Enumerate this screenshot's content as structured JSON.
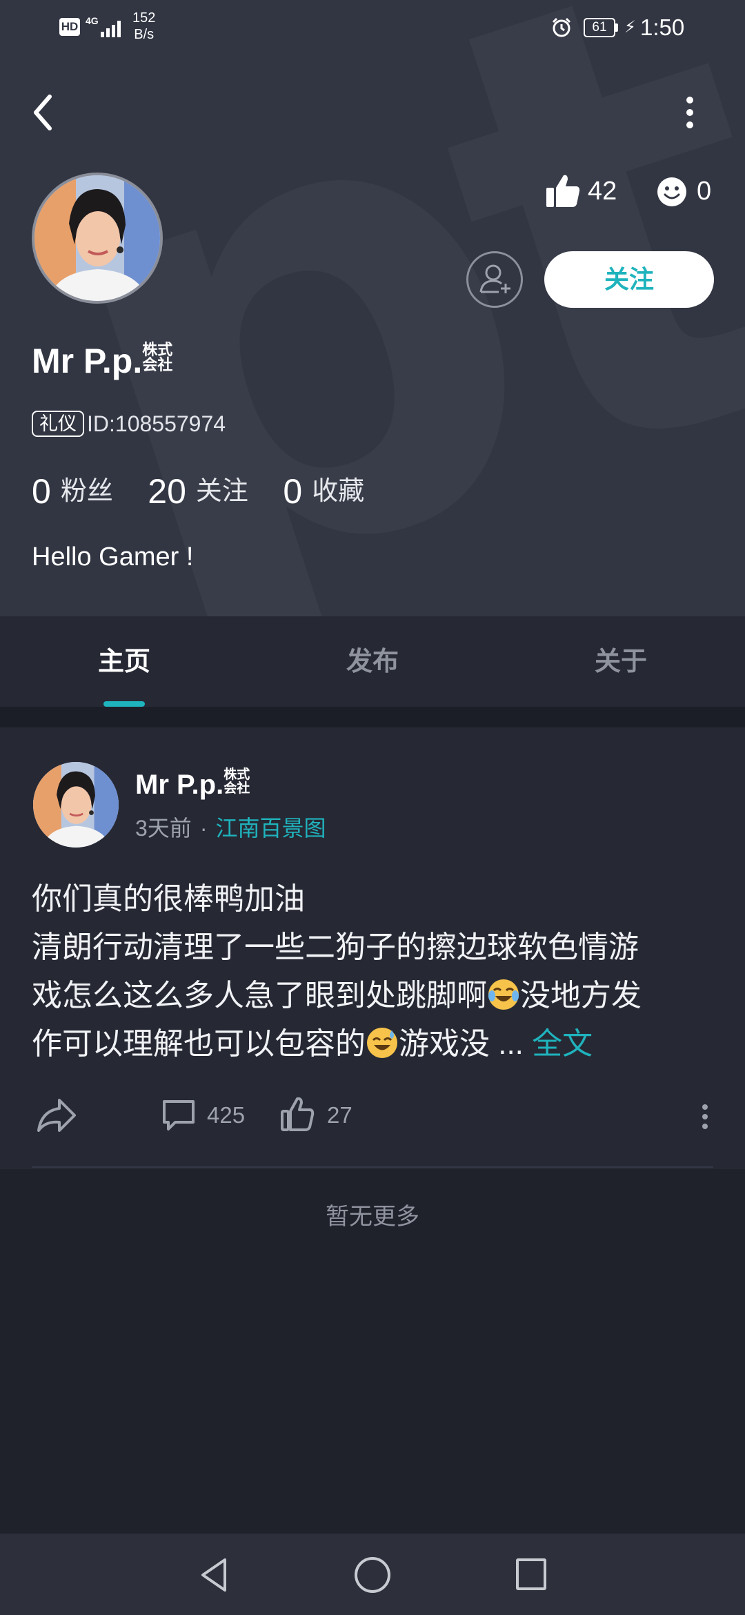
{
  "status_bar": {
    "hd": "HD",
    "network": "4G",
    "speed_value": "152",
    "speed_unit": "B/s",
    "battery": "61",
    "time": "1:50"
  },
  "watermark": "ptar",
  "profile": {
    "likes": "42",
    "reactions": "0",
    "follow_label": "关注",
    "username": "Mr P.p.",
    "username_tag": "株式会社",
    "badge": "礼仪",
    "id_text": "ID:108557974",
    "counts": [
      {
        "value": "0",
        "label": "粉丝"
      },
      {
        "value": "20",
        "label": "关注"
      },
      {
        "value": "0",
        "label": "收藏"
      }
    ],
    "bio": "Hello Gamer !"
  },
  "tabs": [
    "主页",
    "发布",
    "关于"
  ],
  "active_tab": "主页",
  "post": {
    "author": "Mr P.p.",
    "author_tag": "株式会社",
    "time": "3天前",
    "dot": "·",
    "topic": "江南百景图",
    "line1": "你们真的很棒鸭加油",
    "line2": "清朗行动清理了一些二狗子的擦边球软色情游",
    "line3a": "戏怎么这么多人急了眼到处跳脚啊",
    "line3b": "没地方发",
    "line4a": "作可以理解也可以包容的",
    "line4b": "游戏没 ... ",
    "read_more": "全文",
    "comments": "425",
    "likes": "27"
  },
  "footer_text": "暂无更多",
  "colors": {
    "accent": "#1fb3bd",
    "header_bg": "#323643",
    "page_bg": "#1f212b",
    "card_bg": "#262934"
  },
  "icons": {
    "back": "chevron-left-icon",
    "more": "more-vertical-icon",
    "like": "thumbs-up-icon",
    "smile": "smile-icon",
    "add_friend": "add-user-icon",
    "share": "share-icon",
    "comment": "comment-icon",
    "nav_back": "triangle-back-icon",
    "nav_home": "circle-home-icon",
    "nav_recent": "square-recent-icon"
  }
}
